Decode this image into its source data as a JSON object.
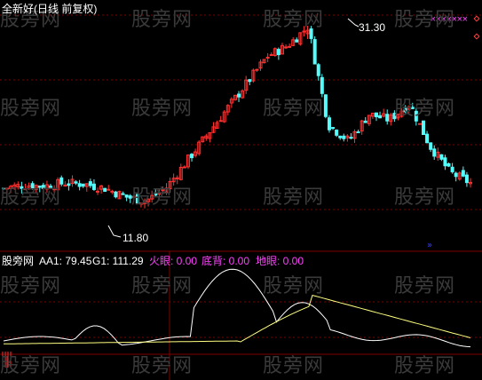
{
  "title": "全新好(日线 前复权)",
  "watermark": "股旁网",
  "max_label": "31.30",
  "min_label": "11.80",
  "indicator": {
    "name": "股旁网",
    "aa1_label": "AA1: 79.45",
    "g1_label": "G1: 111.29",
    "huoyan_label": "火眼: 0.00",
    "dibei_label": "底背: 0.00",
    "diyan_label": "地眼: 0.00"
  },
  "colors": {
    "up": "#ff3232",
    "down": "#54fcfc",
    "grid": "#800000",
    "white_line": "#ffffff",
    "yellow_line": "#ffff80",
    "magenta": "#ff40ff",
    "blue_marker": "#3c3cff"
  },
  "chart_data": {
    "type": "candlestick",
    "x_axis": "trading days",
    "price_max": 31.3,
    "price_min": 11.8,
    "price_trend": [
      16.0,
      16.3,
      16.2,
      16.5,
      16.4,
      16.0,
      15.2,
      14.8,
      16.0,
      18.5,
      21.0,
      23.5,
      26.0,
      28.5,
      29.5,
      31.3,
      22.0,
      20.5,
      23.0,
      22.5,
      24.0,
      20.0,
      17.5,
      16.5
    ],
    "indicator_series": [
      {
        "name": "AA1",
        "color": "white",
        "last": 79.45
      },
      {
        "name": "G1",
        "color": "yellow",
        "last": 111.29
      }
    ]
  }
}
